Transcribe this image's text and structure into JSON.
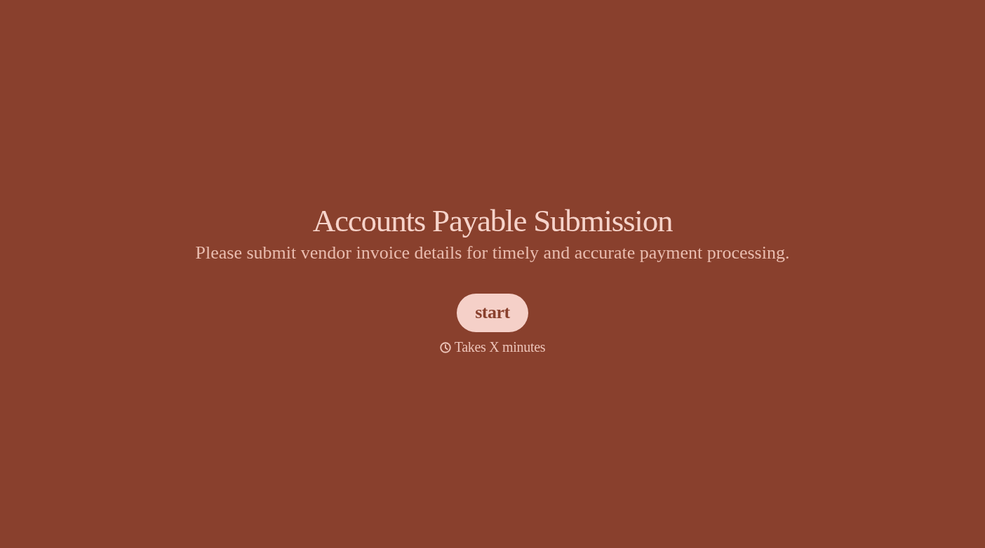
{
  "title": "Accounts Payable Submission",
  "subtitle": "Please submit vendor invoice details for timely and accurate payment processing.",
  "start_button": {
    "label": "start"
  },
  "duration": {
    "text": "Takes X minutes"
  }
}
